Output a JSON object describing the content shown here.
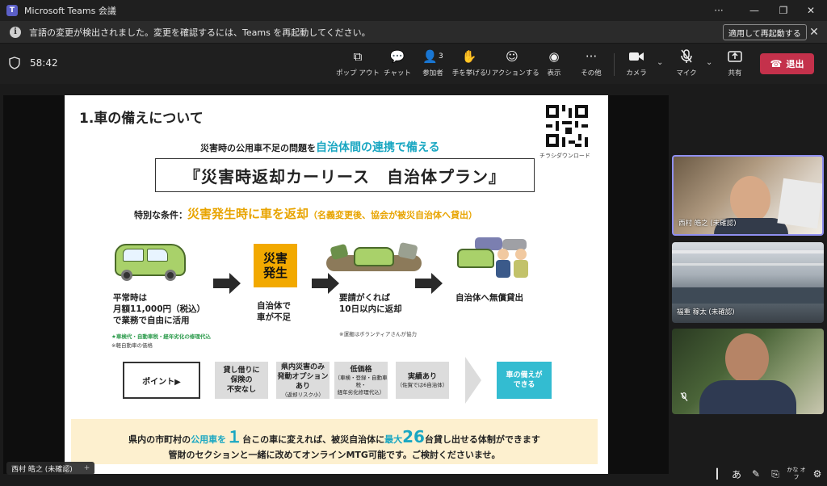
{
  "window": {
    "title": "Microsoft Teams 会議",
    "app_icon_letter": "T",
    "controls": {
      "more": "···",
      "minimize": "—",
      "restore": "❐",
      "close": "✕"
    }
  },
  "notification": {
    "message": "言語の変更が検出されました。変更を確認するには、Teams を再起動してください。",
    "action_label": "適用して再起動する",
    "info_glyph": "i",
    "close_glyph": "✕"
  },
  "toolbar": {
    "timer": "58:42",
    "participant_count": "3",
    "buttons": [
      {
        "id": "popout",
        "label": "ポップ アウト",
        "icon": "popout-icon",
        "glyph": "⧉"
      },
      {
        "id": "chat",
        "label": "チャット",
        "icon": "chat-icon",
        "glyph": "💬"
      },
      {
        "id": "people",
        "label": "参加者",
        "icon": "people-icon",
        "glyph": "👤"
      },
      {
        "id": "raise-hand",
        "label": "手を挙げる",
        "icon": "hand-icon",
        "glyph": "✋"
      },
      {
        "id": "react",
        "label": "リアクションする",
        "icon": "smile-icon",
        "glyph": "☺"
      },
      {
        "id": "view",
        "label": "表示",
        "icon": "view-icon",
        "glyph": "◉"
      },
      {
        "id": "more",
        "label": "その他",
        "icon": "more-icon",
        "glyph": "···"
      },
      {
        "id": "camera",
        "label": "カメラ",
        "icon": "camera-icon",
        "glyph": "▶"
      },
      {
        "id": "mic",
        "label": "マイク",
        "icon": "mic-off-icon",
        "glyph": "🎙"
      },
      {
        "id": "share",
        "label": "共有",
        "icon": "share-icon",
        "glyph": "⬆"
      }
    ],
    "leave_label": "退出",
    "chevron_glyph": "⌄"
  },
  "slide": {
    "title": "1.車の備えについて",
    "qr_label": "チラシダウンロード",
    "subtitle_pre": "災害時の公用車不足の問題を",
    "subtitle_hl": "自治体間の連携で備える",
    "banner": "『災害時返却カーリース　自治体プラン』",
    "condition_pre": "特別な条件：",
    "condition_hl": "災害発生時に車を返却",
    "condition_note": "（名義変更後、協会が被災自治体へ貸出）",
    "step1_lines": [
      "平常時は",
      "月額11,000円（税込）",
      "で業務で自由に活用"
    ],
    "step1_green": "★車検代・自動車税・経年劣化の修理代込",
    "step1_small": "※軽自動車の価格",
    "disaster_box": [
      "災害",
      "発生"
    ],
    "step2_lines": [
      "自治体で",
      "車が不足"
    ],
    "step3_lines": [
      "要請がくれば",
      "10日以内に返却"
    ],
    "step3_small": "※運搬はボランティアさんが協力",
    "step4_lines": [
      "自治体へ無償貸出"
    ],
    "point_label": "ポイント▶",
    "points": [
      {
        "main": [
          "貸し借りに",
          "保険の",
          "不安なし"
        ],
        "sub": []
      },
      {
        "main": [
          "県内災害のみ",
          "発動オプションあり"
        ],
        "sub": [
          "（返却リスク小）"
        ]
      },
      {
        "main": [
          "低価格"
        ],
        "sub": [
          "（車検・登録・自動車税・",
          "経年劣化修理代込）"
        ]
      },
      {
        "main": [
          "実績あり"
        ],
        "sub": [
          "（佐賀では6自治体）"
        ]
      }
    ],
    "ready_label": [
      "車の備えが",
      "できる"
    ],
    "footer_l1_pre": "県内の市町村の",
    "footer_l1_hl1": "公用車を",
    "footer_l1_big1": "１",
    "footer_l1_mid1": "台",
    "footer_l1_mid2": "この車に変えれば、被災自治体に",
    "footer_l1_hl2": "最大",
    "footer_l1_big2": "26",
    "footer_l1_mid3": "台貸",
    "footer_l1_post": "し出せる体制ができます",
    "footer_l2": "管財のセクションと一緒に改めてオンラインMTG可能です。ご検討くださいませ。"
  },
  "presenter": {
    "name": "西村 皓之 (未確認)",
    "plus": "+"
  },
  "participants": [
    {
      "name": "西村 皓之 (未確認)"
    },
    {
      "name": "福重 稼太 (未確認)"
    },
    {
      "name": ""
    }
  ],
  "bottom_controls": [
    "┃",
    "あ",
    "✎",
    "⎘",
    "かな オフ",
    "⚙"
  ],
  "colors": {
    "accent": "#5b5fc7",
    "leave": "#c4314b",
    "slide_cyan": "#1aa7c2",
    "slide_orange": "#e8a400",
    "footer_bg": "#fdf0cf"
  }
}
